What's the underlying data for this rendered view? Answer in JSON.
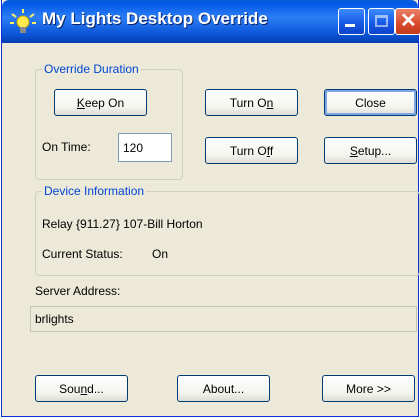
{
  "window": {
    "title": "My Lights Desktop Override"
  },
  "override": {
    "legend": "Override Duration",
    "keep_on_pre": "",
    "keep_on_ul": "K",
    "keep_on_post": "eep On",
    "on_time_label": "On Time:",
    "on_time_value": "120"
  },
  "buttons": {
    "turn_on_pre": "Turn O",
    "turn_on_ul": "n",
    "turn_on_post": "",
    "turn_off_pre": "Turn O",
    "turn_off_ul": "f",
    "turn_off_post": "f",
    "close": "Close",
    "setup_pre": "",
    "setup_ul": "S",
    "setup_post": "etup...",
    "sound_pre": "Sou",
    "sound_ul": "n",
    "sound_post": "d...",
    "about": "About...",
    "more": "More >>"
  },
  "device": {
    "legend": "Device Information",
    "relay": "Relay {911.27} 107-Bill Horton",
    "status_label": "Current Status:",
    "status_value": "On"
  },
  "server": {
    "label": "Server Address:",
    "value": "brlights"
  },
  "colors": {
    "titlebar": "#0a55d8",
    "dialog_bg": "#ece9d8",
    "legend": "#0046d5"
  }
}
